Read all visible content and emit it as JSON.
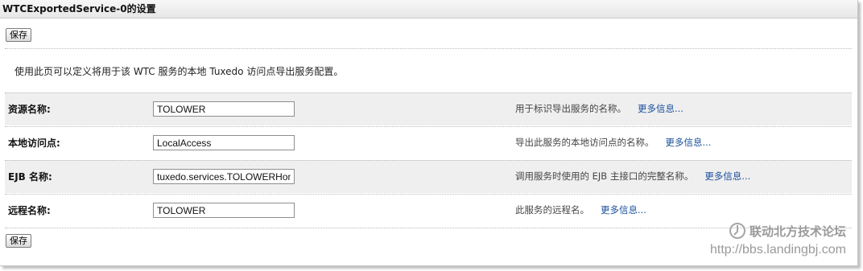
{
  "title": "WTCExportedService-0的设置",
  "save_button_label": "保存",
  "intro": "使用此页可以定义将用于该 WTC 服务的本地 Tuxedo 访问点导出服务配置。",
  "fields": [
    {
      "label": "资源名称:",
      "value": "TOLOWER",
      "help": "用于标识导出服务的名称。",
      "more": "更多信息..."
    },
    {
      "label": "本地访问点:",
      "value": "LocalAccess",
      "help": "导出此服务的本地访问点的名称。",
      "more": "更多信息..."
    },
    {
      "label": "EJB 名称:",
      "value": "tuxedo.services.TOLOWERHome",
      "help": "调用服务时使用的 EJB 主接口的完整名称。",
      "more": "更多信息..."
    },
    {
      "label": "远程名称:",
      "value": "TOLOWER",
      "help": "此服务的远程名。",
      "more": "更多信息..."
    }
  ],
  "watermark": {
    "name": "联动北方技术论坛",
    "url": "http://bbs.landingbj.com"
  }
}
